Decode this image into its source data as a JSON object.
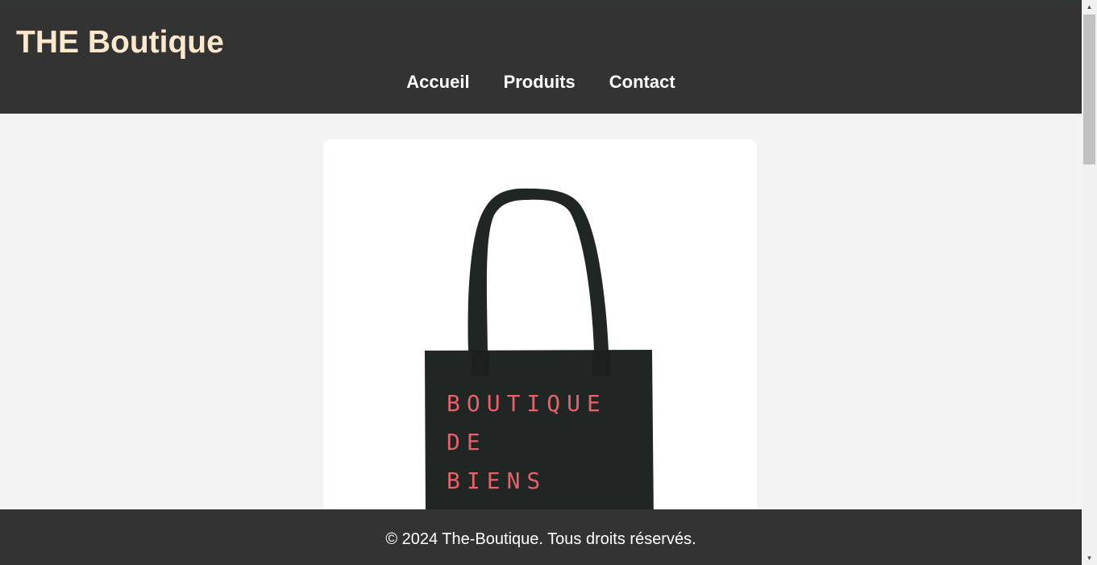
{
  "header": {
    "site_title": "THE Boutique",
    "nav": [
      {
        "label": "Accueil"
      },
      {
        "label": "Produits"
      },
      {
        "label": "Contact"
      }
    ]
  },
  "product": {
    "bag_text": [
      "BOUTIQUE",
      "DE",
      "BIENS"
    ],
    "bag_color": "#1f2623",
    "text_color": "#e5626b"
  },
  "footer": {
    "text": "© 2024 The-Boutique. Tous droits réservés."
  },
  "colors": {
    "header_bg": "#333333",
    "title_color": "#fde8cc",
    "page_bg": "#f3f3f3"
  }
}
